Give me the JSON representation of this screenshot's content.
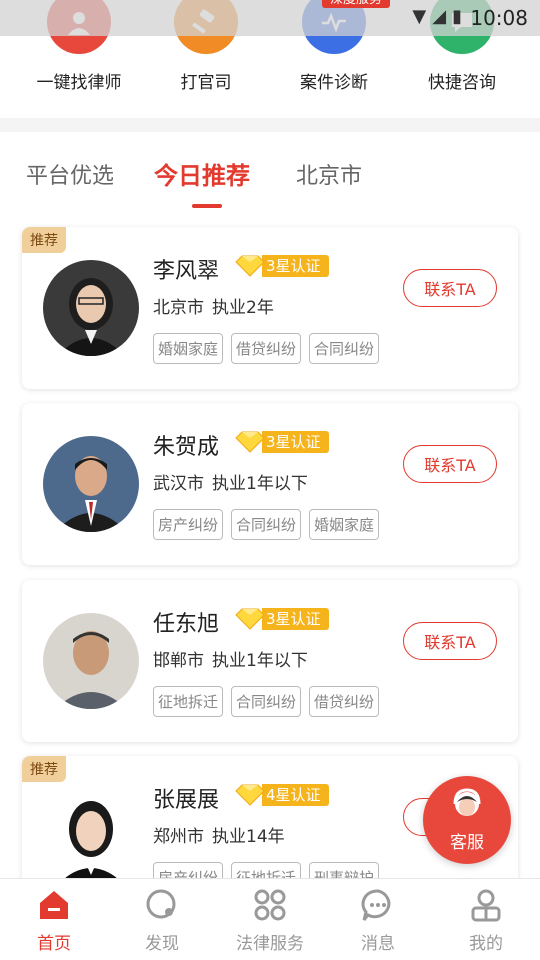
{
  "status_bar": {
    "time": "10:08",
    "promo": "深度服务"
  },
  "quick_actions": [
    {
      "label": "一键找律师",
      "icon": "lawyer-person-icon",
      "color": "#e8483c"
    },
    {
      "label": "打官司",
      "icon": "gavel-icon",
      "color": "#f08b26"
    },
    {
      "label": "案件诊断",
      "icon": "diagnosis-pulse-icon",
      "color": "#3b6fe3"
    },
    {
      "label": "快捷咨询",
      "icon": "chat-consult-icon",
      "color": "#2fb36a"
    }
  ],
  "tabs": [
    {
      "label": "平台优选",
      "active": false
    },
    {
      "label": "今日推荐",
      "active": true
    },
    {
      "label": "北京市",
      "active": false
    }
  ],
  "recommend_label": "推荐",
  "contact_label": "联系TA",
  "lawyers": [
    {
      "name": "李风翠",
      "badge": "3星认证",
      "city": "北京市",
      "experience": "执业2年",
      "tags": [
        "婚姻家庭",
        "借贷纠纷",
        "合同纠纷"
      ],
      "recommended": true
    },
    {
      "name": "朱贺成",
      "badge": "3星认证",
      "city": "武汉市",
      "experience": "执业1年以下",
      "tags": [
        "房产纠纷",
        "合同纠纷",
        "婚姻家庭"
      ],
      "recommended": false
    },
    {
      "name": "任东旭",
      "badge": "3星认证",
      "city": "邯郸市",
      "experience": "执业1年以下",
      "tags": [
        "征地拆迁",
        "合同纠纷",
        "借贷纠纷"
      ],
      "recommended": false
    },
    {
      "name": "张展展",
      "badge": "4星认证",
      "city": "郑州市",
      "experience": "执业14年",
      "tags": [
        "房产纠纷",
        "征地拆迁",
        "刑事辩护"
      ],
      "recommended": true
    }
  ],
  "floating_service": {
    "label": "客服"
  },
  "bottom_nav": [
    {
      "label": "首页",
      "icon": "home-icon",
      "active": true
    },
    {
      "label": "发现",
      "icon": "discover-icon",
      "active": false
    },
    {
      "label": "法律服务",
      "icon": "services-grid-icon",
      "active": false
    },
    {
      "label": "消息",
      "icon": "message-icon",
      "active": false
    },
    {
      "label": "我的",
      "icon": "profile-icon",
      "active": false
    }
  ],
  "colors": {
    "accent": "#e23a2e",
    "badge": "#f5b41c",
    "recommend_tag": "#f1cf9a"
  }
}
